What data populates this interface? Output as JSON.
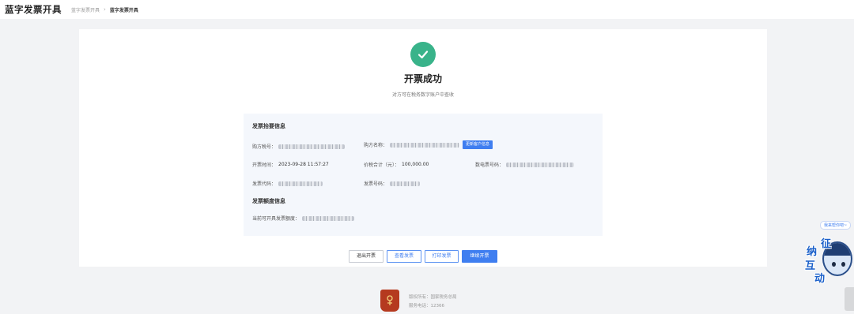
{
  "header": {
    "app_title": "蓝字发票开具",
    "breadcrumbs": [
      "蓝字发票开具",
      "蓝字发票开具"
    ]
  },
  "result": {
    "icon": "check-circle-icon",
    "title": "开票成功",
    "subtitle": "对方可在税务数字账户中查收"
  },
  "summary": {
    "section_title": "发票抬要信息",
    "buyer_tax_no_label": "购方税号：",
    "buyer_name_label": "购方名称：",
    "update_customer_button": "更新客户信息",
    "issue_time_label": "开票时间：",
    "issue_time_value": "2023-09-28 11:57:27",
    "total_label": "价税合计（元）：",
    "total_value": "100,000.00",
    "digital_invoice_no_label": "数电票号码：",
    "invoice_code_label": "发票代码：",
    "invoice_no_label": "发票号码："
  },
  "quota": {
    "section_title": "发票额度信息",
    "current_quota_label": "当前可开具发票额度："
  },
  "actions": {
    "exit_label": "退出开票",
    "view_label": "查看发票",
    "print_label": "打印发票",
    "continue_label": "继续开票"
  },
  "footer": {
    "copyright": "版权所有：国家税务总局",
    "hotline": "服务电话：12366"
  },
  "assistant": {
    "bubble_text": "我来帮你吧~",
    "characters": [
      "征",
      "纳",
      "互",
      "动"
    ]
  },
  "colors": {
    "primary": "#3f7ef0",
    "success": "#39b38a",
    "emblem": "#b53a1f"
  }
}
